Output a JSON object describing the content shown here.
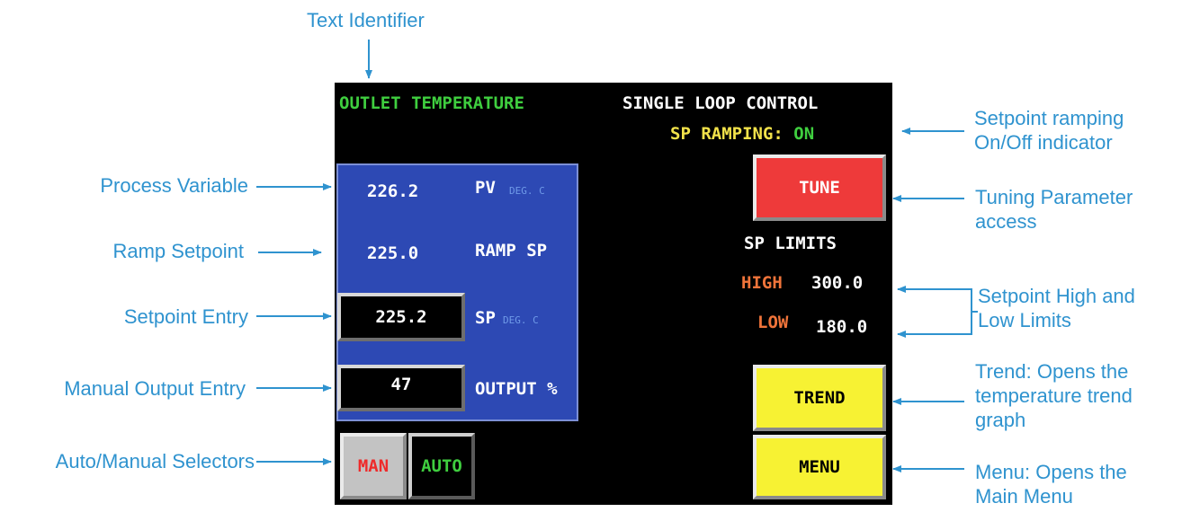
{
  "callouts": {
    "text_identifier": "Text Identifier",
    "process_variable": "Process Variable",
    "ramp_setpoint": "Ramp Setpoint",
    "setpoint_entry": "Setpoint Entry",
    "manual_output_entry": "Manual Output Entry",
    "auto_manual_selectors": "Auto/Manual Selectors",
    "sp_ramping_indicator": [
      "Setpoint ramping",
      "On/Off indicator"
    ],
    "tuning_access": [
      "Tuning Parameter",
      "access"
    ],
    "sp_limits": [
      "Setpoint High and",
      "Low Limits"
    ],
    "trend": [
      "Trend: Opens the",
      "temperature trend",
      "graph"
    ],
    "menu": [
      "Menu: Opens the",
      "Main Menu"
    ]
  },
  "screen": {
    "identifier": "OUTLET TEMPERATURE",
    "title": "SINGLE LOOP CONTROL",
    "ramping_label": "SP RAMPING:",
    "ramping_state": "ON",
    "pv_value": "226.2",
    "pv_label": "PV",
    "pv_unit": "DEG. C",
    "ramp_sp_value": "225.0",
    "ramp_sp_label": "RAMP SP",
    "sp_value": "225.2",
    "sp_label": "SP",
    "sp_unit": "DEG. C",
    "output_value": "47",
    "output_label": "OUTPUT %",
    "tune_button": "TUNE",
    "sp_limits_label": "SP LIMITS",
    "high_label": "HIGH",
    "high_value": "300.0",
    "low_label": "LOW",
    "low_value": "180.0",
    "trend_button": "TREND",
    "menu_button": "MENU",
    "man_button": "MAN",
    "auto_button": "AUTO"
  },
  "colors": {
    "callout": "#2f93cf",
    "identifier": "#3fce3f",
    "ramping": "#f2e24a",
    "panel": "#2d49b4",
    "tune": "#ee3a3a",
    "yellow_button": "#f7f233",
    "limit_label": "#f0743a",
    "man": "#ee2b2b",
    "auto": "#3fce3f"
  }
}
